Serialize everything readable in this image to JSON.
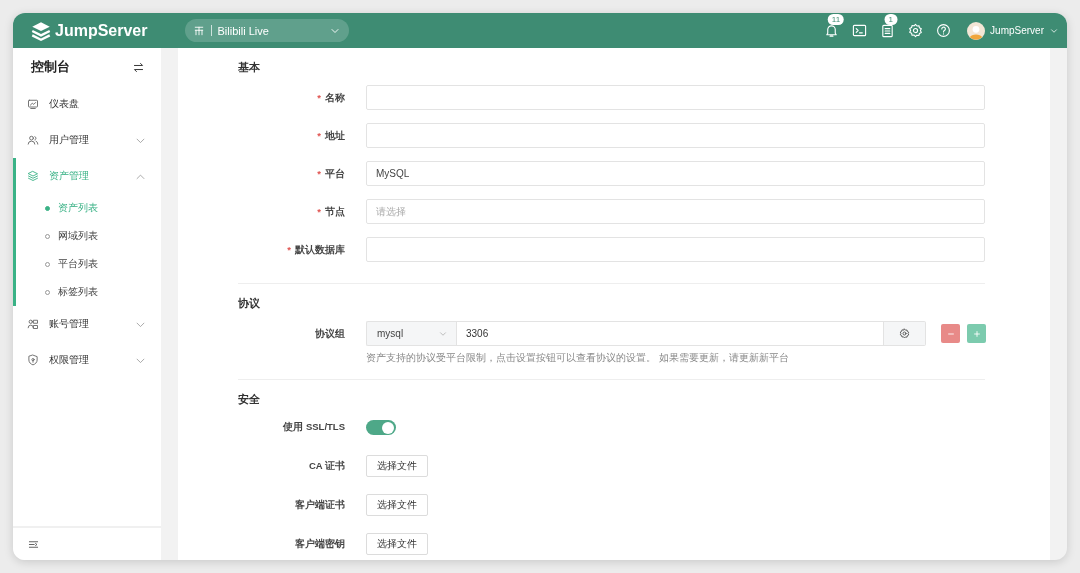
{
  "header": {
    "logo": "JumpServer",
    "org_selector": "Bilibili Live",
    "notifications_badge": "11",
    "tickets_badge": "1",
    "user": "JumpServer"
  },
  "sidebar": {
    "title": "控制台",
    "items": [
      {
        "label": "仪表盘",
        "selected": false
      },
      {
        "label": "用户管理",
        "expanded": false,
        "selected": false
      },
      {
        "label": "资产管理",
        "expanded": true,
        "selected": true,
        "children": [
          {
            "label": "资产列表",
            "selected": true
          },
          {
            "label": "网域列表",
            "selected": false
          },
          {
            "label": "平台列表",
            "selected": false
          },
          {
            "label": "标签列表",
            "selected": false
          }
        ]
      },
      {
        "label": "账号管理",
        "expanded": false,
        "selected": false
      },
      {
        "label": "权限管理",
        "expanded": false,
        "selected": false
      }
    ]
  },
  "form": {
    "sections": [
      {
        "title": "基本",
        "fields": [
          {
            "kind": "input",
            "required_mark": "*",
            "label": "名称"
          },
          {
            "kind": "input",
            "required_mark": "*",
            "label": "地址"
          },
          {
            "kind": "input",
            "required_mark": "*",
            "label": "平台",
            "value": "MySQL"
          },
          {
            "kind": "input",
            "required_mark": "*",
            "label": "节点",
            "placeholder": "请选择"
          },
          {
            "kind": "input",
            "required_mark": "*",
            "label": "默认数据库"
          }
        ]
      },
      {
        "title": "协议",
        "fields": [
          {
            "kind": "protocol",
            "label": "协议组",
            "protocol": "mysql",
            "port": "3306",
            "help": "资产支持的协议受平台限制，点击设置按钮可以查看协议的设置。 如果需要更新，请更新新平台"
          }
        ]
      },
      {
        "title": "安全",
        "fields": [
          {
            "kind": "switch",
            "label": "使用 SSL/TLS",
            "on": true
          },
          {
            "kind": "file",
            "label": "CA 证书",
            "button": "选择文件"
          },
          {
            "kind": "file",
            "label": "客户端证书",
            "button": "选择文件"
          },
          {
            "kind": "file",
            "label": "客户端密钥",
            "button": "选择文件"
          }
        ]
      }
    ]
  }
}
